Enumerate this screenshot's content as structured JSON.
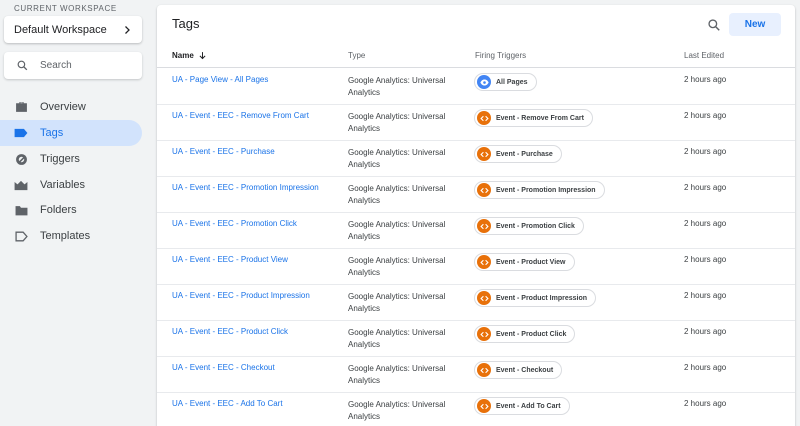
{
  "sidebar": {
    "workspace_caption": "CURRENT WORKSPACE",
    "workspace_name": "Default Workspace",
    "search_placeholder": "Search",
    "items": [
      {
        "label": "Overview",
        "icon": "briefcase-icon"
      },
      {
        "label": "Tags",
        "icon": "tag-icon"
      },
      {
        "label": "Triggers",
        "icon": "trigger-icon"
      },
      {
        "label": "Variables",
        "icon": "variables-icon"
      },
      {
        "label": "Folders",
        "icon": "folder-icon"
      },
      {
        "label": "Templates",
        "icon": "template-icon"
      }
    ],
    "active_index": 1
  },
  "panel": {
    "title": "Tags",
    "new_label": "New",
    "columns": {
      "name": "Name",
      "type": "Type",
      "triggers": "Firing Triggers",
      "edited": "Last Edited"
    }
  },
  "rows": [
    {
      "name": "UA - Page View - All Pages",
      "type": "Google Analytics: Universal Analytics",
      "trigger": "All Pages",
      "trigger_icon": "eye-icon",
      "edited": "2 hours ago"
    },
    {
      "name": "UA - Event - EEC - Remove From Cart",
      "type": "Google Analytics: Universal Analytics",
      "trigger": "Event - Remove From Cart",
      "trigger_icon": "code-icon",
      "edited": "2 hours ago"
    },
    {
      "name": "UA - Event - EEC - Purchase",
      "type": "Google Analytics: Universal Analytics",
      "trigger": "Event - Purchase",
      "trigger_icon": "code-icon",
      "edited": "2 hours ago"
    },
    {
      "name": "UA - Event - EEC - Promotion Impression",
      "type": "Google Analytics: Universal Analytics",
      "trigger": "Event - Promotion Impression",
      "trigger_icon": "code-icon",
      "edited": "2 hours ago"
    },
    {
      "name": "UA - Event - EEC - Promotion Click",
      "type": "Google Analytics: Universal Analytics",
      "trigger": "Event - Promotion Click",
      "trigger_icon": "code-icon",
      "edited": "2 hours ago"
    },
    {
      "name": "UA - Event - EEC - Product View",
      "type": "Google Analytics: Universal Analytics",
      "trigger": "Event - Product View",
      "trigger_icon": "code-icon",
      "edited": "2 hours ago"
    },
    {
      "name": "UA - Event - EEC - Product Impression",
      "type": "Google Analytics: Universal Analytics",
      "trigger": "Event - Product Impression",
      "trigger_icon": "code-icon",
      "edited": "2 hours ago"
    },
    {
      "name": "UA - Event - EEC - Product Click",
      "type": "Google Analytics: Universal Analytics",
      "trigger": "Event - Product Click",
      "trigger_icon": "code-icon",
      "edited": "2 hours ago"
    },
    {
      "name": "UA - Event - EEC - Checkout",
      "type": "Google Analytics: Universal Analytics",
      "trigger": "Event - Checkout",
      "trigger_icon": "code-icon",
      "edited": "2 hours ago"
    },
    {
      "name": "UA - Event - EEC - Add To Cart",
      "type": "Google Analytics: Universal Analytics",
      "trigger": "Event - Add To Cart",
      "trigger_icon": "code-icon",
      "edited": "2 hours ago"
    }
  ],
  "colors": {
    "accent": "#1a73e8",
    "active_nav_bg": "#d2e3fc",
    "event_trigger": "#e8710a",
    "pageview_trigger": "#4285f4"
  }
}
